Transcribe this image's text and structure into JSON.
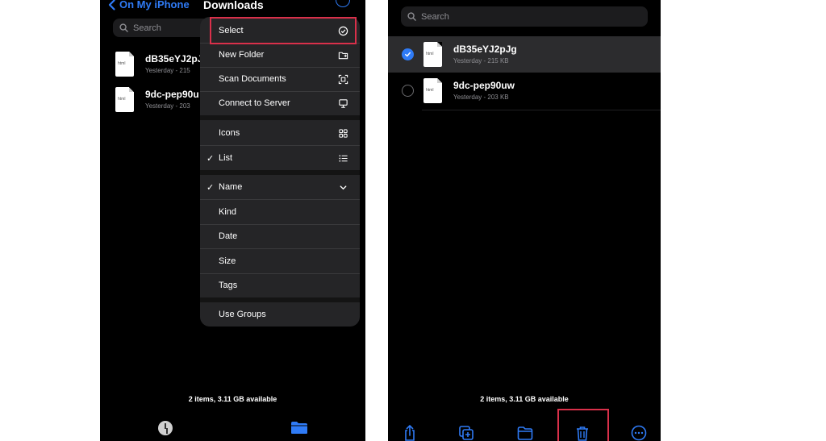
{
  "left_screen": {
    "nav": {
      "back_label": "On My iPhone",
      "title": "Downloads"
    },
    "search": {
      "placeholder": "Search"
    },
    "files": [
      {
        "name": "dB35eYJ2pJ",
        "meta": "Yesterday - 215",
        "icon_label": "html"
      },
      {
        "name": "9dc-pep90u",
        "meta": "Yesterday - 203",
        "icon_label": "html"
      }
    ],
    "menu": {
      "items": [
        {
          "label": "Select",
          "icon": "checkmark-circle-icon"
        },
        {
          "label": "New Folder",
          "icon": "folder-plus-icon"
        },
        {
          "label": "Scan Documents",
          "icon": "doc-scan-icon"
        },
        {
          "label": "Connect to Server",
          "icon": "display-icon"
        },
        {
          "label": "Icons",
          "icon": "grid-icon"
        },
        {
          "label": "List",
          "icon": "list-icon",
          "checked": true
        },
        {
          "label": "Name",
          "icon": "chevron-down-icon",
          "checked": true
        },
        {
          "label": "Kind"
        },
        {
          "label": "Date"
        },
        {
          "label": "Size"
        },
        {
          "label": "Tags"
        },
        {
          "label": "Use Groups"
        }
      ],
      "check_glyph": "✓"
    },
    "storage": "2 items, 3.11 GB available",
    "tabs": [
      "recents-icon",
      "browse-folder-icon"
    ]
  },
  "right_screen": {
    "search": {
      "placeholder": "Search"
    },
    "files": [
      {
        "name": "dB35eYJ2pJg",
        "meta": "Yesterday - 215 KB",
        "icon_label": "html",
        "selected": true
      },
      {
        "name": "9dc-pep90uw",
        "meta": "Yesterday - 203 KB",
        "icon_label": "html",
        "selected": false
      }
    ],
    "storage": "2 items, 3.11 GB available",
    "toolbar": [
      "share-icon",
      "duplicate-icon",
      "move-folder-icon",
      "trash-icon",
      "more-icon"
    ]
  },
  "colors": {
    "accent": "#2f7bf6",
    "highlight": "#d9304a",
    "menu_bg": "#252527"
  }
}
